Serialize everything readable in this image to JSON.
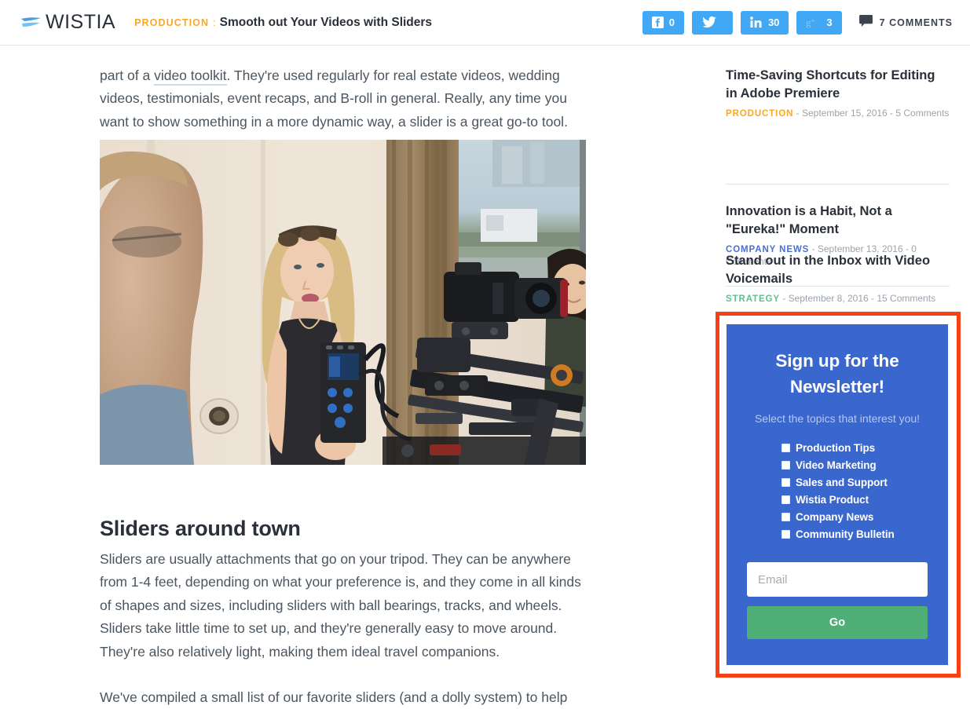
{
  "header": {
    "logo_text": "WISTIA",
    "logo_icon": "wistia-swoosh-icon",
    "category": "PRODUCTION",
    "separator": ":",
    "title": "Smooth out Your Videos with Sliders",
    "share_buttons": [
      {
        "network": "facebook",
        "icon": "facebook-icon",
        "count": "0"
      },
      {
        "network": "twitter",
        "icon": "twitter-icon",
        "count": ""
      },
      {
        "network": "linkedin",
        "icon": "linkedin-icon",
        "count": "30"
      },
      {
        "network": "googleplus",
        "icon": "google-plus-icon",
        "count": "3"
      }
    ],
    "comments": {
      "icon": "comment-bubble-icon",
      "label": "7 COMMENTS"
    }
  },
  "article": {
    "intro_before_link": "part of a ",
    "intro_link": "video toolkit",
    "intro_after_link": ". They're used regularly for real estate videos, wedding videos, testimonials, event recaps, and B-roll in general. Really, any time you want to show something in a more dynamic way, a slider is a great go-to tool.",
    "photo_alt": "Video crew filming with a camera slider in a hotel room",
    "section_heading": "Sliders around town",
    "paragraph_sliders": "Sliders are usually attachments that go on your tripod. They can be anywhere from 1-4 feet, depending on what your preference is, and they come in all kinds of shapes and sizes, including sliders with ball bearings, tracks, and wheels. Sliders take little time to set up, and they're generally easy to move around. They're also relatively light, making them ideal travel companions.",
    "paragraph_compiled": "We've compiled a small list of our favorite sliders (and a dolly system) to help"
  },
  "sidebar": {
    "posts": [
      {
        "title": "Time-Saving Shortcuts for Editing in Adobe Premiere",
        "category": "PRODUCTION",
        "category_color": "#f9a825",
        "meta": " - September 15, 2016 - 5 Comments"
      },
      {
        "title": "Innovation is a Habit, Not a \"Eureka!\" Moment",
        "category": "COMPANY NEWS",
        "category_color": "#4b6fd0",
        "meta": " - September 13, 2016 - 0 Comments"
      },
      {
        "title": "Stand out in the Inbox with Video Voicemails",
        "category": "STRATEGY",
        "category_color": "#5fc08a",
        "meta": " - September 8, 2016 - 15 Comments"
      }
    ]
  },
  "newsletter": {
    "heading": "Sign up for the Newsletter!",
    "subheading": "Select the topics that interest you!",
    "topics": [
      {
        "label": "Production Tips",
        "checked": false
      },
      {
        "label": "Video Marketing",
        "checked": false
      },
      {
        "label": "Sales and Support",
        "checked": false
      },
      {
        "label": "Wistia Product",
        "checked": false
      },
      {
        "label": "Company News",
        "checked": false
      },
      {
        "label": "Community Bulletin",
        "checked": false
      }
    ],
    "email_placeholder": "Email",
    "email_value": "",
    "submit_label": "Go",
    "highlight_color": "#f93f15",
    "panel_color": "#3a67ce",
    "submit_color": "#4fb077"
  }
}
